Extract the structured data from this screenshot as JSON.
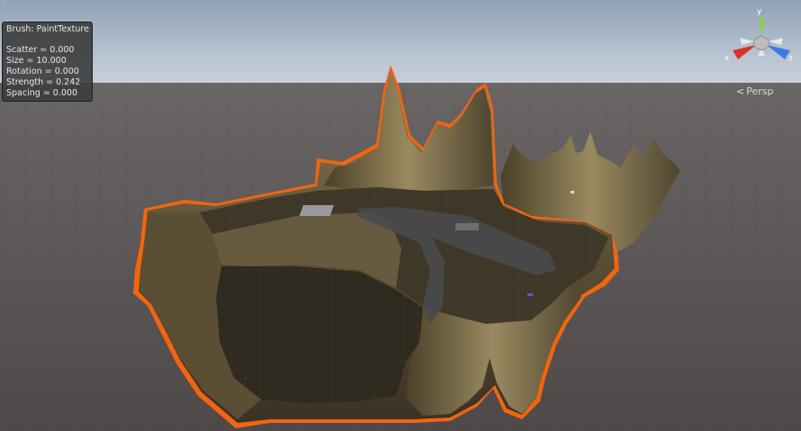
{
  "brush": {
    "title": "Brush: PaintTexture",
    "rows": [
      "Scatter = 0.000",
      "Size = 10.000",
      "Rotation = 0.000",
      "Strength = 0.242",
      "Spacing = 0.000"
    ]
  },
  "gizmo": {
    "y_label": "y",
    "x_label": "x",
    "z_label": "z",
    "colors": {
      "x": "#d9312b",
      "y": "#8dd137",
      "z": "#3a7be6",
      "neutral": "#e0e0e0"
    }
  },
  "view": {
    "projection_label": "Persp",
    "chevron_icon": "chevron-left-icon"
  },
  "scene": {
    "selected_object": "terrain",
    "selection_outline_color": "#f26a10",
    "sky_color": "#b8c6d4",
    "ground_color": "#5c5656",
    "terrain_color": "#6b5e40"
  }
}
